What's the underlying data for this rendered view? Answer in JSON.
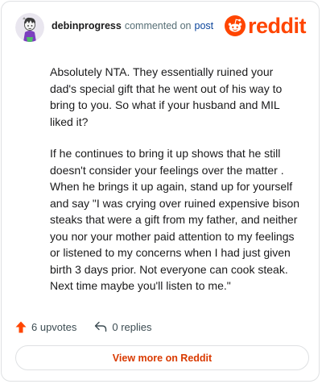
{
  "header": {
    "username": "debinprogress",
    "action": "commented on",
    "post_link": "post",
    "brand": "reddit"
  },
  "comment": {
    "paragraphs": [
      "Absolutely NTA. They essentially ruined your dad's special gift that he went out of his way to bring to you. So what if your husband and MIL liked it?",
      "If he continues to bring it up shows that he still doesn't consider your feelings over the matter . When he brings it up again, stand up for yourself and say \"I was crying over ruined expensive bison steaks that were a gift from my father, and neither you nor your mother paid attention to my feelings or listened to my concerns when I had just given birth 3 days prior. Not everyone can cook steak. Next time maybe you'll listen to me.\""
    ]
  },
  "actions": {
    "upvotes": "6 upvotes",
    "replies": "0 replies"
  },
  "footer": {
    "view_more": "View more on Reddit"
  },
  "colors": {
    "brand": "#ff4500",
    "link": "#0a449b",
    "button_text": "#d93a00"
  }
}
